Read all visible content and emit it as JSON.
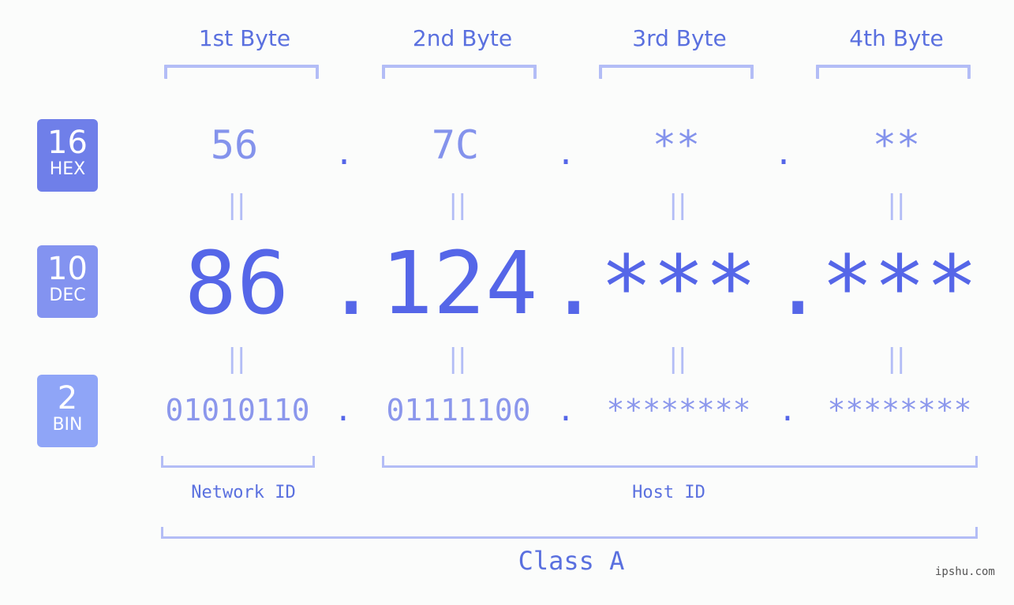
{
  "bytes": {
    "headers": [
      "1st Byte",
      "2nd Byte",
      "3rd Byte",
      "4th Byte"
    ],
    "hex": [
      "56",
      "7C",
      "**",
      "**"
    ],
    "dec": [
      "86",
      "124",
      "***",
      "***"
    ],
    "bin": [
      "01010110",
      "01111100",
      "********",
      "********"
    ],
    "separator": ".",
    "equals": "||"
  },
  "bases": [
    {
      "number": "16",
      "label": "HEX",
      "color": "#6f7fe9"
    },
    {
      "number": "10",
      "label": "DEC",
      "color": "#8393f0"
    },
    {
      "number": "2",
      "label": "BIN",
      "color": "#8fa5f7"
    }
  ],
  "segments": {
    "network": "Network ID",
    "host": "Host ID",
    "class": "Class A"
  },
  "watermark": "ipshu.com",
  "colors": {
    "primary": "#5566e8",
    "bracket": "#b3bdf6",
    "text": "#5a70df"
  }
}
